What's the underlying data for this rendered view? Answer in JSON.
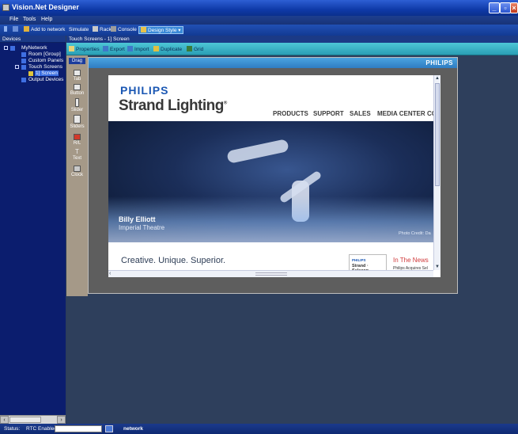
{
  "window": {
    "title": "Vision.Net Designer"
  },
  "menu": [
    "File",
    "Tools",
    "Help"
  ],
  "toolbar": {
    "add_to_network": "Add to network",
    "simulate": "Simulate",
    "rack": "Rack",
    "console": "Console",
    "design_style": "Design Style"
  },
  "devices": {
    "header": "Devices",
    "tree": {
      "root": "MyNetwork",
      "room": "Room [Group]",
      "custom_panels": "Custom Panels",
      "touch_screens": "Touch Screens",
      "screen": "1] Screen",
      "output_devices": "Output Devices"
    }
  },
  "document": {
    "breadcrumb": "Touch Screens - 1] Screen",
    "toolbar": {
      "properties": "Properties",
      "export": "Export",
      "import": "Import",
      "duplicate": "Duplicate",
      "grid": "Grid"
    }
  },
  "palette": {
    "drag": "Drag",
    "items": [
      "Tab",
      "Button",
      "Slider",
      "Sliders",
      "R/L",
      "Text",
      "Clock"
    ]
  },
  "screen": {
    "logo": "PHILIPS"
  },
  "website": {
    "brand": "PHILIPS",
    "product": "Strand Lighting",
    "trademark": "®",
    "nav": [
      "PRODUCTS",
      "SUPPORT",
      "SALES",
      "MEDIA CENTER",
      "CC"
    ],
    "hero_title": "Billy Elliott",
    "hero_subtitle": "Imperial Theatre",
    "hero_credit": "Photo Credit: Da",
    "tagline": "Creative. Unique. Superior.",
    "ad_brand": "PHILIPS",
    "ad_product": "Strand · Selecon",
    "news_heading": "In The News",
    "news_item": "Philips Acquires Sel"
  },
  "status": {
    "label": "Status:",
    "rtc": "RTC Enabled",
    "network": "network"
  }
}
